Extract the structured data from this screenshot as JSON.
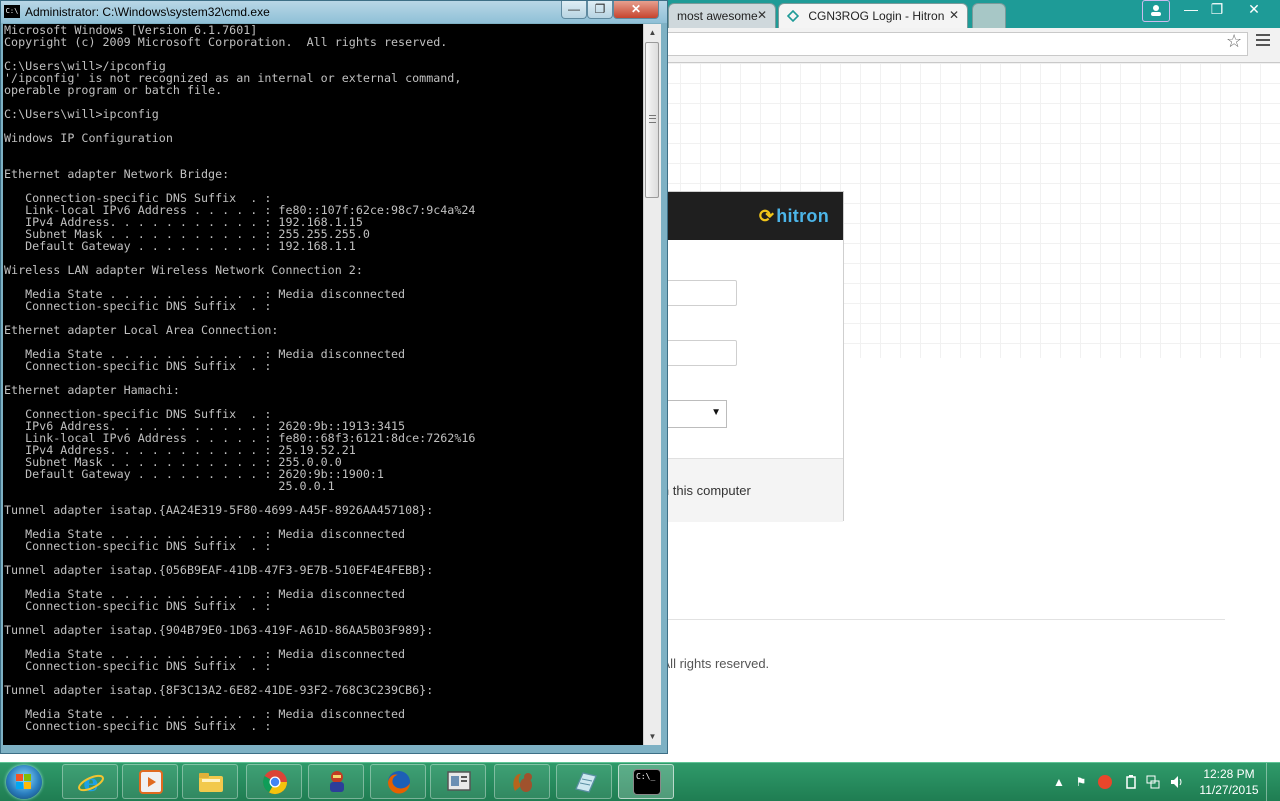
{
  "browser": {
    "tabs": [
      {
        "label": "most awesome",
        "active": false
      },
      {
        "label": "CGN3ROG Login - Hitron",
        "active": true
      }
    ],
    "tab_close_glyph": "✕",
    "window_buttons": {
      "minimize": "—",
      "maximize": "❐",
      "close": "✕"
    },
    "page": {
      "logo_text": "hitron",
      "remember_text": "me on this computer",
      "copyright_text": ". All rights reserved."
    }
  },
  "cmd": {
    "title": "Administrator: C:\\Windows\\system32\\cmd.exe",
    "icon_label": "C:\\",
    "buttons": {
      "minimize": "—",
      "maximize": "❐",
      "close": "✕"
    },
    "console_lines": [
      "Microsoft Windows [Version 6.1.7601]",
      "Copyright (c) 2009 Microsoft Corporation.  All rights reserved.",
      "",
      "C:\\Users\\will>/ipconfig",
      "'/ipconfig' is not recognized as an internal or external command,",
      "operable program or batch file.",
      "",
      "C:\\Users\\will>ipconfig",
      "",
      "Windows IP Configuration",
      "",
      "",
      "Ethernet adapter Network Bridge:",
      "",
      "   Connection-specific DNS Suffix  . :",
      "   Link-local IPv6 Address . . . . . : fe80::107f:62ce:98c7:9c4a%24",
      "   IPv4 Address. . . . . . . . . . . : 192.168.1.15",
      "   Subnet Mask . . . . . . . . . . . : 255.255.255.0",
      "   Default Gateway . . . . . . . . . : 192.168.1.1",
      "",
      "Wireless LAN adapter Wireless Network Connection 2:",
      "",
      "   Media State . . . . . . . . . . . : Media disconnected",
      "   Connection-specific DNS Suffix  . :",
      "",
      "Ethernet adapter Local Area Connection:",
      "",
      "   Media State . . . . . . . . . . . : Media disconnected",
      "   Connection-specific DNS Suffix  . :",
      "",
      "Ethernet adapter Hamachi:",
      "",
      "   Connection-specific DNS Suffix  . :",
      "   IPv6 Address. . . . . . . . . . . : 2620:9b::1913:3415",
      "   Link-local IPv6 Address . . . . . : fe80::68f3:6121:8dce:7262%16",
      "   IPv4 Address. . . . . . . . . . . : 25.19.52.21",
      "   Subnet Mask . . . . . . . . . . . : 255.0.0.0",
      "   Default Gateway . . . . . . . . . : 2620:9b::1900:1",
      "                                       25.0.0.1",
      "",
      "Tunnel adapter isatap.{AA24E319-5F80-4699-A45F-8926AA457108}:",
      "",
      "   Media State . . . . . . . . . . . : Media disconnected",
      "   Connection-specific DNS Suffix  . :",
      "",
      "Tunnel adapter isatap.{056B9EAF-41DB-47F3-9E7B-510EF4E4FEBB}:",
      "",
      "   Media State . . . . . . . . . . . : Media disconnected",
      "   Connection-specific DNS Suffix  . :",
      "",
      "Tunnel adapter isatap.{904B79E0-1D63-419F-A61D-86AA5B03F989}:",
      "",
      "   Media State . . . . . . . . . . . : Media disconnected",
      "   Connection-specific DNS Suffix  . :",
      "",
      "Tunnel adapter isatap.{8F3C13A2-6E82-41DE-93F2-768C3C239CB6}:",
      "",
      "   Media State . . . . . . . . . . . : Media disconnected",
      "   Connection-specific DNS Suffix  . :"
    ],
    "scroll_up_glyph": "▲",
    "scroll_down_glyph": "▼"
  },
  "taskbar": {
    "clock_time": "12:28 PM",
    "clock_date": "11/27/2015",
    "cmd_button_label": "C:\\_",
    "tray_arrow": "▲",
    "icons": [
      "windows-logo-icon",
      "internet-explorer-icon",
      "media-player-icon",
      "file-explorer-icon",
      "chrome-icon",
      "game-character-icon",
      "firefox-icon",
      "monitor-app-icon",
      "squirrel-app-icon",
      "notes-app-icon",
      "command-prompt-icon"
    ]
  },
  "colors": {
    "browser_frame": "#1e9b97",
    "console_bg": "#000000",
    "console_text": "#c0c0c0",
    "taskbar": "#2a8f61",
    "hitron_blue": "#4cb5e8",
    "hitron_yellow": "#f0c419"
  }
}
